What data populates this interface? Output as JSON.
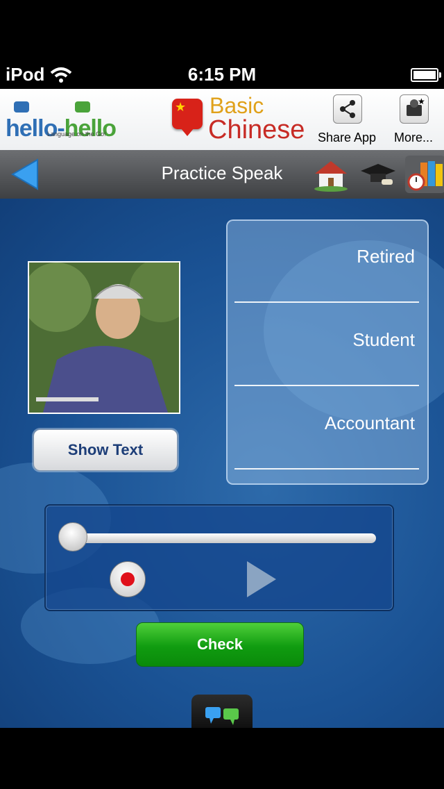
{
  "status_bar": {
    "carrier": "iPod",
    "time": "6:15 PM"
  },
  "header": {
    "brand_left": "hello-",
    "brand_right": "hello",
    "tagline": "Language on the Go!",
    "app_title_line1": "Basic",
    "app_title_line2": "Chinese",
    "share_label": "Share App",
    "more_label": "More..."
  },
  "nav": {
    "title": "Practice Speak"
  },
  "practice": {
    "show_text_label": "Show Text",
    "answers": [
      "Retired",
      "Student",
      "Accountant"
    ],
    "playback_position": 0,
    "check_label": "Check"
  },
  "colors": {
    "brand_blue": "#2f6fb5",
    "brand_green": "#4aa33a",
    "content_blue": "#1a5294",
    "check_green": "#109c10",
    "record_red": "#e0101a"
  }
}
